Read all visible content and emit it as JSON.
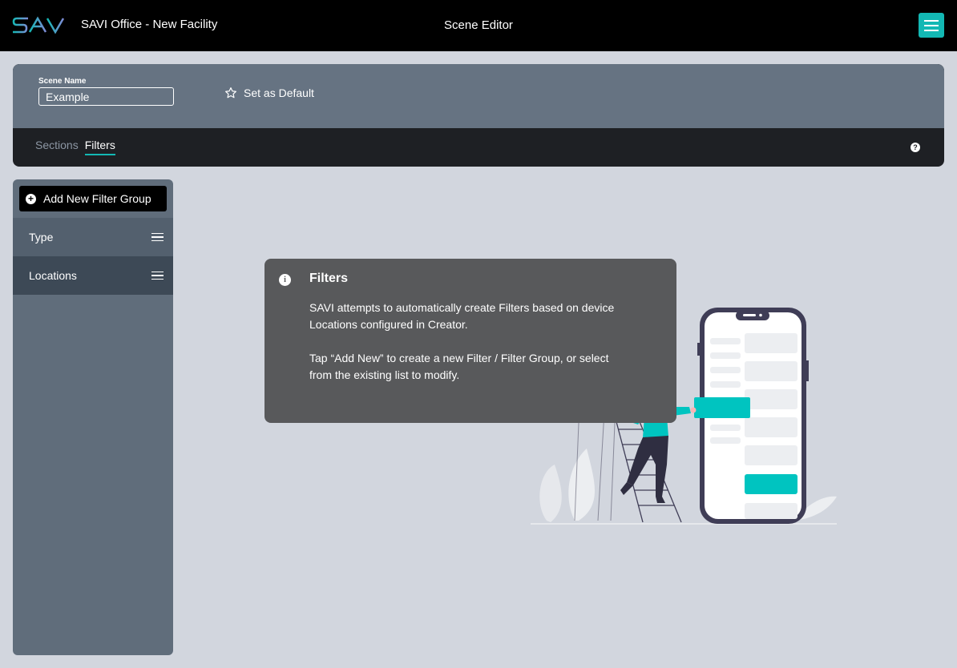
{
  "header": {
    "logo_text": "SAVI",
    "app_title": "SAVI Office - New Facility",
    "page_title": "Scene Editor",
    "menu_icon": "hamburger-menu-icon"
  },
  "scene": {
    "name_label": "Scene Name",
    "name_value": "Example",
    "set_default_label": "Set as Default",
    "tabs": [
      {
        "label": "Sections",
        "active": false
      },
      {
        "label": "Filters",
        "active": true
      }
    ],
    "help_icon": "?"
  },
  "sidebar": {
    "add_button_label": "Add New Filter Group",
    "items": [
      {
        "label": "Type"
      },
      {
        "label": "Locations"
      }
    ]
  },
  "info": {
    "title": "Filters",
    "paragraph1": "SAVI attempts to automatically create Filters based on device Locations configured in Creator.",
    "paragraph2": "Tap “Add New” to create a new Filter / Filter Group, or select from the existing list to modify."
  },
  "colors": {
    "accent": "#13b8b4",
    "topbar": "#000000",
    "scene_header": "#667382",
    "tab_bar": "#1e2024",
    "sidebar": "#606d7b",
    "info_card": "#58595b",
    "background": "#d2d6de"
  }
}
